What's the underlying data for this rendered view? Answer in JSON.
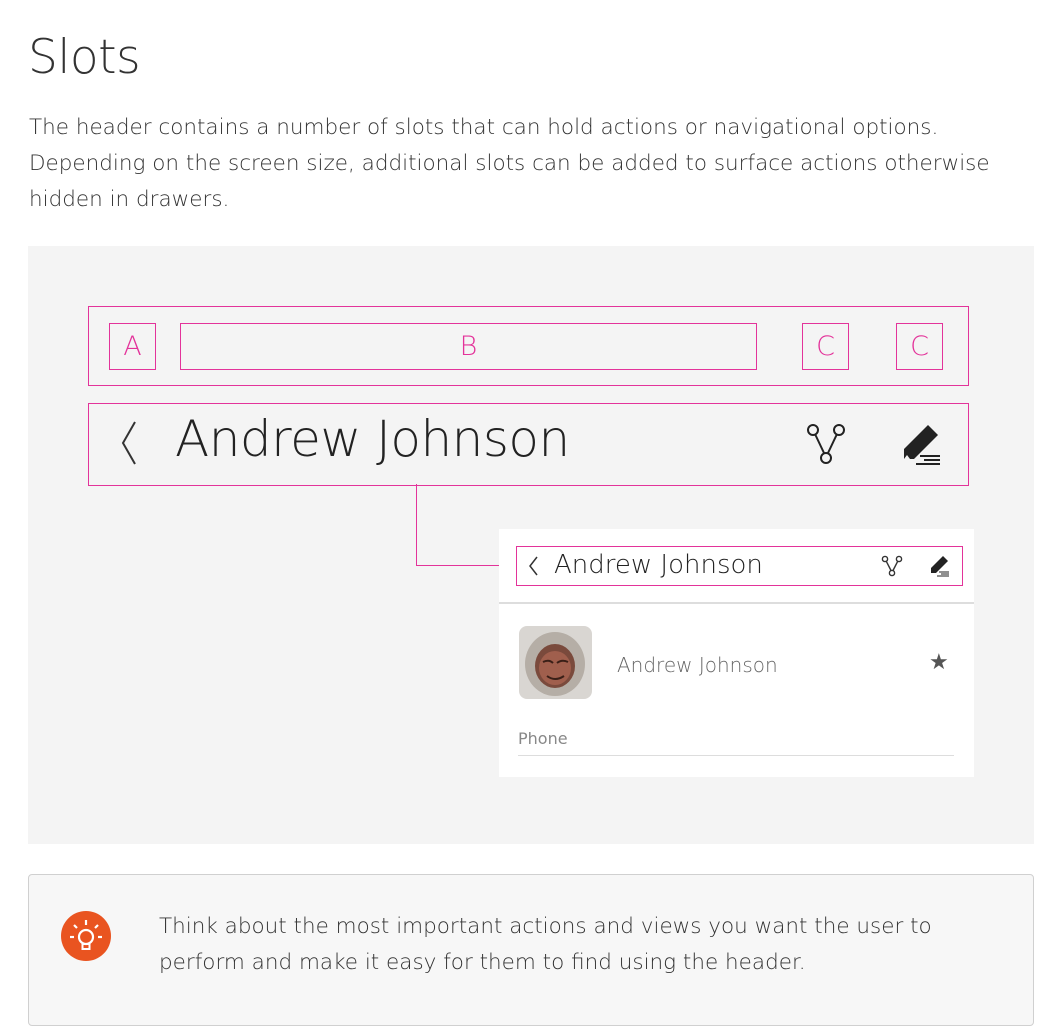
{
  "page": {
    "title": "Slots",
    "intro_lines": [
      "The header contains a number of slots that can hold actions or navigational options.",
      "Depending on the screen size, additional slots can be added to surface actions otherwise",
      "hidden in drawers."
    ]
  },
  "diagram": {
    "slots": {
      "a": "A",
      "b": "B",
      "c1": "C",
      "c2": "C"
    },
    "header_name": "Andrew Johnson",
    "phone": {
      "header_name": "Andrew Johnson",
      "contact_name": "Andrew Johnson",
      "field_label": "Phone"
    }
  },
  "icons": {
    "back": "chevron-left-icon",
    "share": "share-icon",
    "edit": "edit-icon",
    "star": "star-icon",
    "tip": "lightbulb-icon"
  },
  "colors": {
    "accent": "#e3339a",
    "tip_icon": "#e95420",
    "diagram_bg": "#f4f4f4"
  },
  "tip": {
    "lines": [
      "Think about the most important actions and views you want the user to",
      "perform and make it easy for them to find using the header."
    ]
  }
}
